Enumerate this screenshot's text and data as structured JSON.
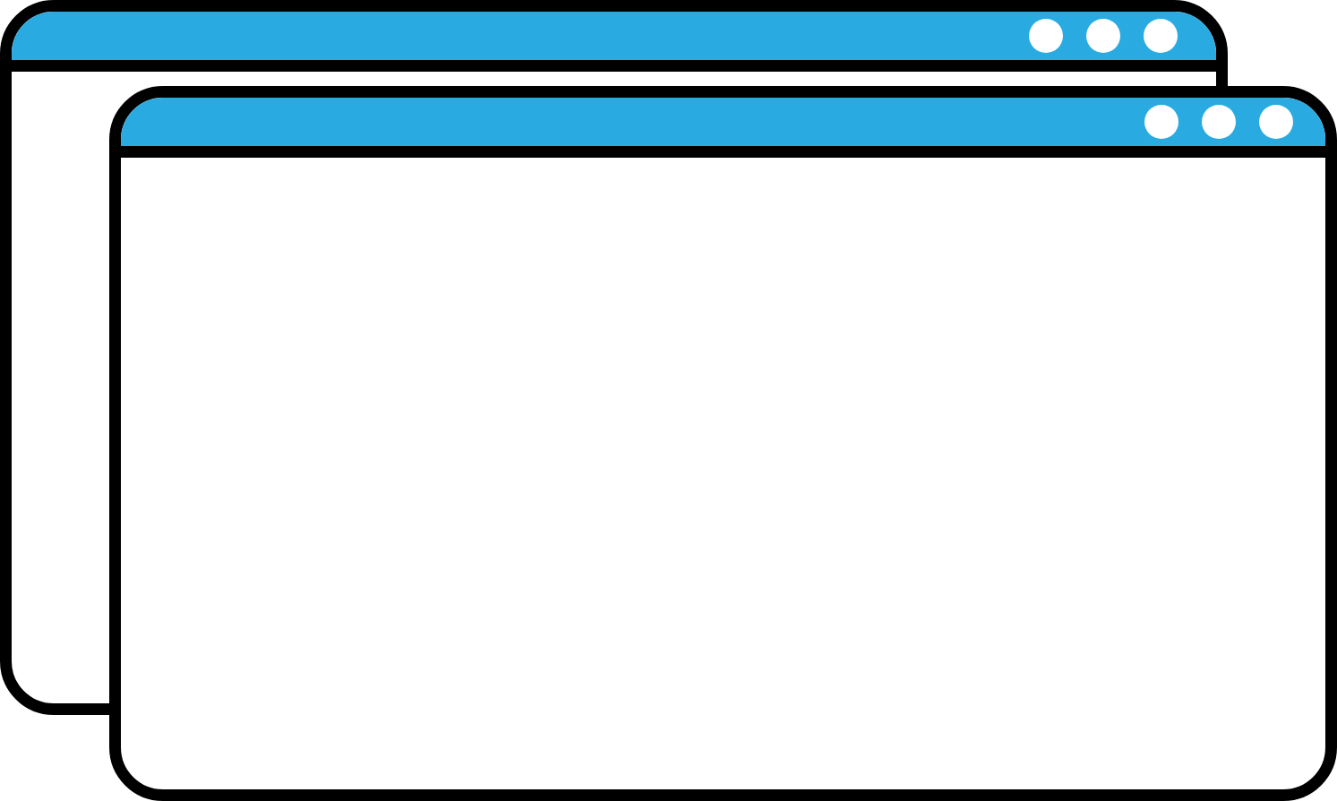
{
  "windows": [
    {
      "kind": "back"
    },
    {
      "kind": "front"
    }
  ]
}
